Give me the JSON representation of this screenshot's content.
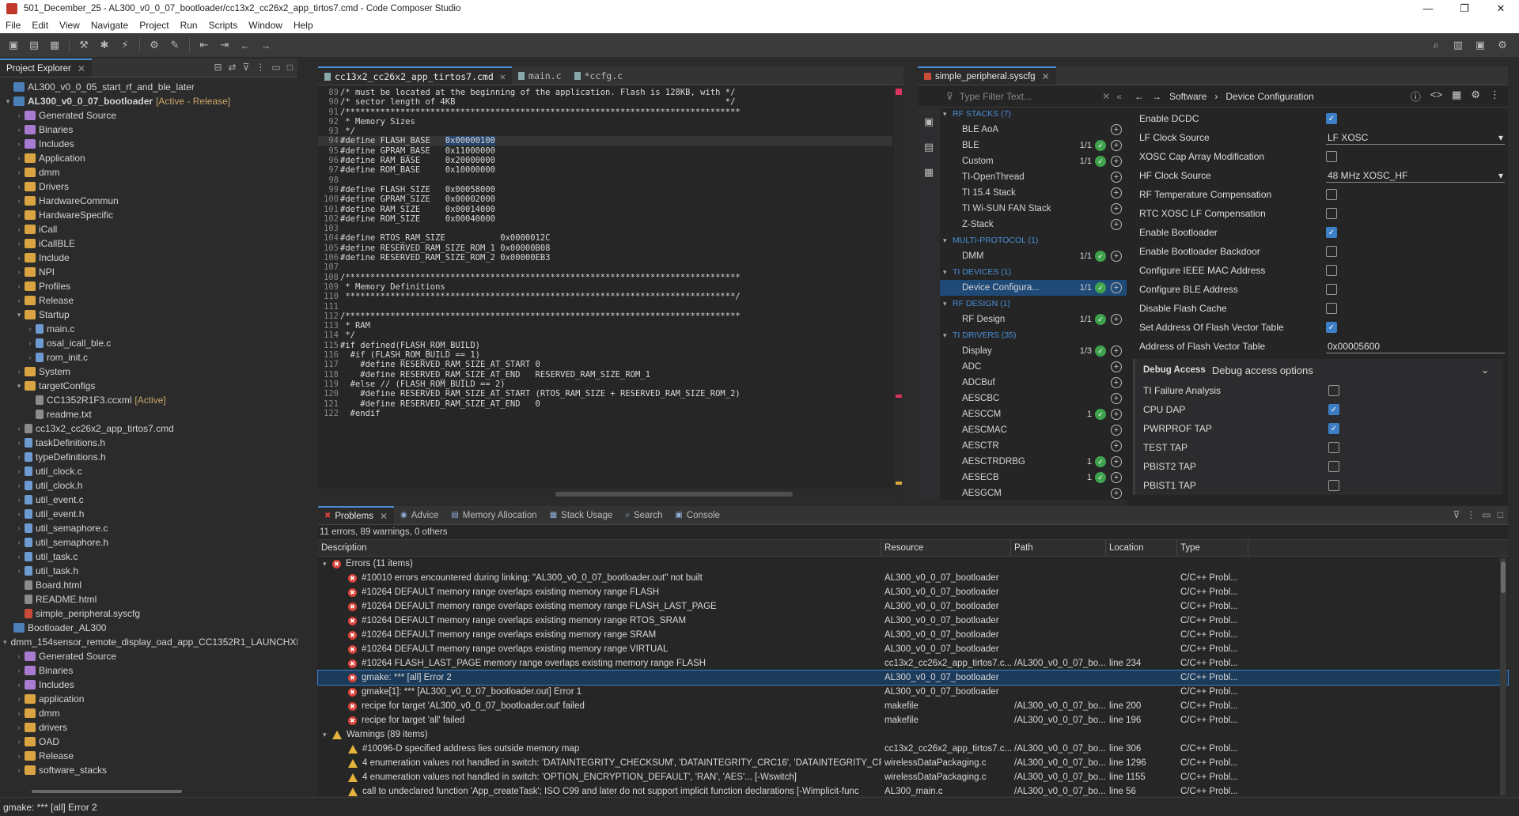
{
  "window": {
    "title": "501_December_25 - AL300_v0_0_07_bootloader/cc13x2_cc26x2_app_tirtos7.cmd - Code Composer Studio",
    "controls": [
      "—",
      "❐",
      "✕"
    ]
  },
  "menu": [
    "File",
    "Edit",
    "View",
    "Navigate",
    "Project",
    "Run",
    "Scripts",
    "Window",
    "Help"
  ],
  "explorer": {
    "title": "Project Explorer",
    "items": [
      {
        "d": 1,
        "tw": "",
        "ic": "proj",
        "label": "AL300_v0_0_05_start_rf_and_ble_later",
        "st": ""
      },
      {
        "d": 1,
        "tw": "▾",
        "ic": "proj",
        "label": "AL300_v0_0_07_bootloader",
        "st": "[Active - Release]",
        "bold": true
      },
      {
        "d": 2,
        "tw": "›",
        "ic": "bin",
        "label": "Generated Source",
        "st": ""
      },
      {
        "d": 2,
        "tw": "›",
        "ic": "bin",
        "label": "Binaries",
        "st": ""
      },
      {
        "d": 2,
        "tw": "›",
        "ic": "bin",
        "label": "Includes",
        "st": ""
      },
      {
        "d": 2,
        "tw": "›",
        "ic": "folder",
        "label": "Application",
        "st": ""
      },
      {
        "d": 2,
        "tw": "›",
        "ic": "folder",
        "label": "dmm",
        "st": ""
      },
      {
        "d": 2,
        "tw": "›",
        "ic": "folder",
        "label": "Drivers",
        "st": ""
      },
      {
        "d": 2,
        "tw": "›",
        "ic": "folder",
        "label": "HardwareCommun",
        "st": ""
      },
      {
        "d": 2,
        "tw": "›",
        "ic": "folder",
        "label": "HardwareSpecific",
        "st": ""
      },
      {
        "d": 2,
        "tw": "›",
        "ic": "folder",
        "label": "iCall",
        "st": ""
      },
      {
        "d": 2,
        "tw": "›",
        "ic": "folder",
        "label": "iCallBLE",
        "st": ""
      },
      {
        "d": 2,
        "tw": "›",
        "ic": "folder",
        "label": "Include",
        "st": ""
      },
      {
        "d": 2,
        "tw": "›",
        "ic": "folder",
        "label": "NPI",
        "st": ""
      },
      {
        "d": 2,
        "tw": "›",
        "ic": "folder",
        "label": "Profiles",
        "st": ""
      },
      {
        "d": 2,
        "tw": "›",
        "ic": "folder",
        "label": "Release",
        "st": ""
      },
      {
        "d": 2,
        "tw": "▾",
        "ic": "folder",
        "label": "Startup",
        "st": ""
      },
      {
        "d": 3,
        "tw": "›",
        "ic": "cfile",
        "label": "main.c",
        "st": ""
      },
      {
        "d": 3,
        "tw": "›",
        "ic": "cfile",
        "label": "osal_icall_ble.c",
        "st": ""
      },
      {
        "d": 3,
        "tw": "›",
        "ic": "cfile",
        "label": "rom_init.c",
        "st": ""
      },
      {
        "d": 2,
        "tw": "›",
        "ic": "folder",
        "label": "System",
        "st": ""
      },
      {
        "d": 2,
        "tw": "▾",
        "ic": "folder",
        "label": "targetConfigs",
        "st": ""
      },
      {
        "d": 3,
        "tw": "",
        "ic": "file",
        "label": "CC1352R1F3.ccxml",
        "st": "[Active]"
      },
      {
        "d": 3,
        "tw": "",
        "ic": "file",
        "label": "readme.txt",
        "st": ""
      },
      {
        "d": 2,
        "tw": "›",
        "ic": "file",
        "label": "cc13x2_cc26x2_app_tirtos7.cmd",
        "st": ""
      },
      {
        "d": 2,
        "tw": "›",
        "ic": "cfile",
        "label": "taskDefinitions.h",
        "st": ""
      },
      {
        "d": 2,
        "tw": "›",
        "ic": "cfile",
        "label": "typeDefinitions.h",
        "st": ""
      },
      {
        "d": 2,
        "tw": "›",
        "ic": "cfile",
        "label": "util_clock.c",
        "st": ""
      },
      {
        "d": 2,
        "tw": "›",
        "ic": "cfile",
        "label": "util_clock.h",
        "st": ""
      },
      {
        "d": 2,
        "tw": "›",
        "ic": "cfile",
        "label": "util_event.c",
        "st": ""
      },
      {
        "d": 2,
        "tw": "›",
        "ic": "cfile",
        "label": "util_event.h",
        "st": ""
      },
      {
        "d": 2,
        "tw": "›",
        "ic": "cfile",
        "label": "util_semaphore.c",
        "st": ""
      },
      {
        "d": 2,
        "tw": "›",
        "ic": "cfile",
        "label": "util_semaphore.h",
        "st": ""
      },
      {
        "d": 2,
        "tw": "›",
        "ic": "cfile",
        "label": "util_task.c",
        "st": ""
      },
      {
        "d": 2,
        "tw": "›",
        "ic": "cfile",
        "label": "util_task.h",
        "st": ""
      },
      {
        "d": 2,
        "tw": "",
        "ic": "file",
        "label": "Board.html",
        "st": ""
      },
      {
        "d": 2,
        "tw": "",
        "ic": "file",
        "label": "README.html",
        "st": ""
      },
      {
        "d": 2,
        "tw": "",
        "ic": "red",
        "label": "simple_peripheral.syscfg",
        "st": ""
      },
      {
        "d": 1,
        "tw": "",
        "ic": "proj",
        "label": "Bootloader_AL300",
        "st": ""
      },
      {
        "d": 1,
        "tw": "▾",
        "ic": "proj",
        "label": "dmm_154sensor_remote_display_oad_app_CC1352R1_LAUNCHXL",
        "st": ""
      },
      {
        "d": 2,
        "tw": "›",
        "ic": "bin",
        "label": "Generated Source",
        "st": ""
      },
      {
        "d": 2,
        "tw": "›",
        "ic": "bin",
        "label": "Binaries",
        "st": ""
      },
      {
        "d": 2,
        "tw": "›",
        "ic": "bin",
        "label": "Includes",
        "st": ""
      },
      {
        "d": 2,
        "tw": "›",
        "ic": "folder",
        "label": "application",
        "st": ""
      },
      {
        "d": 2,
        "tw": "›",
        "ic": "folder",
        "label": "dmm",
        "st": ""
      },
      {
        "d": 2,
        "tw": "›",
        "ic": "folder",
        "label": "drivers",
        "st": ""
      },
      {
        "d": 2,
        "tw": "›",
        "ic": "folder",
        "label": "OAD",
        "st": ""
      },
      {
        "d": 2,
        "tw": "›",
        "ic": "folder",
        "label": "Release",
        "st": ""
      },
      {
        "d": 2,
        "tw": "›",
        "ic": "folder",
        "label": "software_stacks",
        "st": ""
      }
    ]
  },
  "editor": {
    "tabs": [
      {
        "label": "cc13x2_cc26x2_app_tirtos7.cmd",
        "active": true
      },
      {
        "label": "main.c"
      },
      {
        "label": "*ccfg.c"
      }
    ],
    "lines": [
      {
        "n": "89",
        "t": "/* must be located at the beginning of the application. Flash is 128KB, with */",
        "c": "cm"
      },
      {
        "n": "90",
        "t": "/* sector length of 4KB                                                      */",
        "c": "cm"
      },
      {
        "n": "91",
        "t": "/*******************************************************************************",
        "c": "cm"
      },
      {
        "n": "92",
        "t": " * Memory Sizes",
        "c": "cm"
      },
      {
        "n": "93",
        "t": " */",
        "c": "cm"
      },
      {
        "n": "94",
        "t": "#define FLASH_BASE   0x00000100",
        "c": "def",
        "hl": true,
        "selv": "0x00000100"
      },
      {
        "n": "95",
        "t": "#define GPRAM_BASE   0x11000000",
        "c": "def"
      },
      {
        "n": "96",
        "t": "#define RAM_BASE     0x20000000",
        "c": "def"
      },
      {
        "n": "97",
        "t": "#define ROM_BASE     0x10000000",
        "c": "def"
      },
      {
        "n": "98",
        "t": "",
        "c": ""
      },
      {
        "n": "99",
        "t": "#define FLASH_SIZE   0x00058000",
        "c": "def"
      },
      {
        "n": "100",
        "t": "#define GPRAM_SIZE   0x00002000",
        "c": "def"
      },
      {
        "n": "101",
        "t": "#define RAM_SIZE     0x00014000",
        "c": "def"
      },
      {
        "n": "102",
        "t": "#define ROM_SIZE     0x00040000",
        "c": "def"
      },
      {
        "n": "103",
        "t": "",
        "c": ""
      },
      {
        "n": "104",
        "t": "#define RTOS_RAM_SIZE           0x0000012C",
        "c": "def"
      },
      {
        "n": "105",
        "t": "#define RESERVED_RAM_SIZE_ROM_1 0x00000B08",
        "c": "def"
      },
      {
        "n": "106",
        "t": "#define RESERVED_RAM_SIZE_ROM_2 0x00000EB3",
        "c": "def"
      },
      {
        "n": "107",
        "t": "",
        "c": ""
      },
      {
        "n": "108",
        "t": "/*******************************************************************************",
        "c": "cm"
      },
      {
        "n": "109",
        "t": " * Memory Definitions",
        "c": "cm"
      },
      {
        "n": "110",
        "t": " ******************************************************************************/",
        "c": "cm"
      },
      {
        "n": "111",
        "t": "",
        "c": ""
      },
      {
        "n": "112",
        "t": "/*******************************************************************************",
        "c": "cm"
      },
      {
        "n": "113",
        "t": " * RAM",
        "c": "cm"
      },
      {
        "n": "114",
        "t": " */",
        "c": "cm"
      },
      {
        "n": "115",
        "t": "#if defined(FLASH_ROM_BUILD)",
        "c": "def"
      },
      {
        "n": "116",
        "t": "  #if (FLASH_ROM_BUILD == 1)",
        "c": "def"
      },
      {
        "n": "117",
        "t": "    #define RESERVED_RAM_SIZE_AT_START 0",
        "c": "def"
      },
      {
        "n": "118",
        "t": "    #define RESERVED_RAM_SIZE_AT_END   RESERVED_RAM_SIZE_ROM_1",
        "c": "def"
      },
      {
        "n": "119",
        "t": "  #else // (FLASH_ROM_BUILD == 2)",
        "c": "def"
      },
      {
        "n": "120",
        "t": "    #define RESERVED_RAM_SIZE_AT_START (RTOS_RAM_SIZE + RESERVED_RAM_SIZE_ROM_2)",
        "c": "def"
      },
      {
        "n": "121",
        "t": "    #define RESERVED_RAM_SIZE_AT_END   0",
        "c": "def"
      },
      {
        "n": "122",
        "t": "  #endif",
        "c": "def"
      }
    ]
  },
  "syscfg": {
    "tab": "simple_peripheral.syscfg",
    "filter_placeholder": "Type Filter Text...",
    "modules": [
      {
        "h": true,
        "label": "RF STACKS (7)"
      },
      {
        "label": "BLE AoA",
        "cnt": "",
        "ok": false
      },
      {
        "label": "BLE",
        "cnt": "1/1",
        "ok": true
      },
      {
        "label": "Custom",
        "cnt": "1/1",
        "ok": true
      },
      {
        "label": "TI-OpenThread",
        "cnt": "",
        "ok": false
      },
      {
        "label": "TI 15.4 Stack",
        "cnt": "",
        "ok": false
      },
      {
        "label": "TI Wi-SUN FAN Stack",
        "cnt": "",
        "ok": false
      },
      {
        "label": "Z-Stack",
        "cnt": "",
        "ok": false
      },
      {
        "h": true,
        "label": "MULTI-PROTOCOL (1)"
      },
      {
        "label": "DMM",
        "cnt": "1/1",
        "ok": true
      },
      {
        "h": true,
        "label": "TI DEVICES (1)"
      },
      {
        "label": "Device Configura...",
        "cnt": "1/1",
        "ok": true,
        "sel": true
      },
      {
        "h": true,
        "label": "RF DESIGN (1)"
      },
      {
        "label": "RF Design",
        "cnt": "1/1",
        "ok": true
      },
      {
        "h": true,
        "label": "TI DRIVERS (35)"
      },
      {
        "label": "Display",
        "cnt": "1/3",
        "ok": true
      },
      {
        "label": "ADC",
        "cnt": "",
        "ok": false
      },
      {
        "label": "ADCBuf",
        "cnt": "",
        "ok": false
      },
      {
        "label": "AESCBC",
        "cnt": "",
        "ok": false
      },
      {
        "label": "AESCCM",
        "cnt": "1",
        "ok": true
      },
      {
        "label": "AESCMAC",
        "cnt": "",
        "ok": false
      },
      {
        "label": "AESCTR",
        "cnt": "",
        "ok": false
      },
      {
        "label": "AESCTRDRBG",
        "cnt": "1",
        "ok": true
      },
      {
        "label": "AESECB",
        "cnt": "1",
        "ok": true
      },
      {
        "label": "AESGCM",
        "cnt": "",
        "ok": false
      }
    ],
    "breadcrumb": [
      "Software",
      "Device Configuration"
    ],
    "props": [
      {
        "label": "Enable DCDC",
        "type": "cb",
        "on": true
      },
      {
        "label": "LF Clock Source",
        "type": "dd",
        "value": "LF XOSC"
      },
      {
        "label": "XOSC Cap Array Modification",
        "type": "cb",
        "on": false
      },
      {
        "label": "HF Clock Source",
        "type": "dd",
        "value": "48 MHz XOSC_HF"
      },
      {
        "label": "RF Temperature Compensation",
        "type": "cb",
        "on": false
      },
      {
        "label": "RTC XOSC LF Compensation",
        "type": "cb",
        "on": false
      },
      {
        "label": "Enable Bootloader",
        "type": "cb",
        "on": true
      },
      {
        "label": "Enable Bootloader Backdoor",
        "type": "cb",
        "on": false
      },
      {
        "label": "Configure IEEE MAC Address",
        "type": "cb",
        "on": false
      },
      {
        "label": "Configure BLE Address",
        "type": "cb",
        "on": false
      },
      {
        "label": "Disable Flash Cache",
        "type": "cb",
        "on": false
      },
      {
        "label": "Set Address Of Flash Vector Table",
        "type": "cb",
        "on": true
      },
      {
        "label": "Address of Flash Vector Table",
        "type": "tf",
        "value": "0x00005600"
      }
    ],
    "group": {
      "title": "Debug Access",
      "subtitle": "Debug access options",
      "props": [
        {
          "label": "TI Failure Analysis",
          "on": false
        },
        {
          "label": "CPU DAP",
          "on": true
        },
        {
          "label": "PWRPROF TAP",
          "on": true
        },
        {
          "label": "TEST TAP",
          "on": false
        },
        {
          "label": "PBIST2 TAP",
          "on": false
        },
        {
          "label": "PBIST1 TAP",
          "on": false
        }
      ]
    }
  },
  "problems": {
    "tabs": [
      "Problems",
      "Advice",
      "Memory Allocation",
      "Stack Usage",
      "Search",
      "Console"
    ],
    "summary": "11 errors, 89 warnings, 0 others",
    "columns": [
      "Description",
      "Resource",
      "Path",
      "Location",
      "Type"
    ],
    "rows": [
      {
        "k": "grp",
        "ic": "e",
        "d": "Errors (11 items)",
        "r": "",
        "p": "",
        "l": "",
        "t": ""
      },
      {
        "k": "e",
        "d": "#10010 errors encountered during linking; \"AL300_v0_0_07_bootloader.out\" not built",
        "r": "AL300_v0_0_07_bootloader",
        "p": "",
        "l": "",
        "t": "C/C++ Probl..."
      },
      {
        "k": "e",
        "d": "#10264 DEFAULT memory range overlaps existing memory range FLASH",
        "r": "AL300_v0_0_07_bootloader",
        "p": "",
        "l": "",
        "t": "C/C++ Probl..."
      },
      {
        "k": "e",
        "d": "#10264 DEFAULT memory range overlaps existing memory range FLASH_LAST_PAGE",
        "r": "AL300_v0_0_07_bootloader",
        "p": "",
        "l": "",
        "t": "C/C++ Probl..."
      },
      {
        "k": "e",
        "d": "#10264 DEFAULT memory range overlaps existing memory range RTOS_SRAM",
        "r": "AL300_v0_0_07_bootloader",
        "p": "",
        "l": "",
        "t": "C/C++ Probl..."
      },
      {
        "k": "e",
        "d": "#10264 DEFAULT memory range overlaps existing memory range SRAM",
        "r": "AL300_v0_0_07_bootloader",
        "p": "",
        "l": "",
        "t": "C/C++ Probl..."
      },
      {
        "k": "e",
        "d": "#10264 DEFAULT memory range overlaps existing memory range VIRTUAL",
        "r": "AL300_v0_0_07_bootloader",
        "p": "",
        "l": "",
        "t": "C/C++ Probl..."
      },
      {
        "k": "e",
        "d": "#10264 FLASH_LAST_PAGE memory range overlaps existing memory range FLASH",
        "r": "cc13x2_cc26x2_app_tirtos7.c...",
        "p": "/AL300_v0_0_07_bo...",
        "l": "line 234",
        "t": "C/C++ Probl..."
      },
      {
        "k": "e",
        "d": "gmake: *** [all] Error 2",
        "r": "AL300_v0_0_07_bootloader",
        "p": "",
        "l": "",
        "t": "C/C++ Probl...",
        "sel": true
      },
      {
        "k": "e",
        "d": "gmake[1]: *** [AL300_v0_0_07_bootloader.out] Error 1",
        "r": "AL300_v0_0_07_bootloader",
        "p": "",
        "l": "",
        "t": "C/C++ Probl..."
      },
      {
        "k": "e",
        "d": "recipe for target 'AL300_v0_0_07_bootloader.out' failed",
        "r": "makefile",
        "p": "/AL300_v0_0_07_bo...",
        "l": "line 200",
        "t": "C/C++ Probl..."
      },
      {
        "k": "e",
        "d": "recipe for target 'all' failed",
        "r": "makefile",
        "p": "/AL300_v0_0_07_bo...",
        "l": "line 196",
        "t": "C/C++ Probl..."
      },
      {
        "k": "grp",
        "ic": "w",
        "d": "Warnings (89 items)",
        "r": "",
        "p": "",
        "l": "",
        "t": ""
      },
      {
        "k": "w",
        "d": "#10096-D specified address lies outside memory map",
        "r": "cc13x2_cc26x2_app_tirtos7.c...",
        "p": "/AL300_v0_0_07_bo...",
        "l": "line 306",
        "t": "C/C++ Probl..."
      },
      {
        "k": "w",
        "d": "4 enumeration values not handled in switch: 'DATAINTEGRITY_CHECKSUM', 'DATAINTEGRITY_CRC16', 'DATAINTEGRITY_CRC",
        "r": "wirelessDataPackaging.c",
        "p": "/AL300_v0_0_07_bo...",
        "l": "line 1296",
        "t": "C/C++ Probl..."
      },
      {
        "k": "w",
        "d": "4 enumeration values not handled in switch: 'OPTION_ENCRYPTION_DEFAULT', 'RAN', 'AES'... [-Wswitch]",
        "r": "wirelessDataPackaging.c",
        "p": "/AL300_v0_0_07_bo...",
        "l": "line 1155",
        "t": "C/C++ Probl..."
      },
      {
        "k": "w",
        "d": "call to undeclared function 'App_createTask'; ISO C99 and later do not support implicit function declarations [-Wimplicit-func",
        "r": "AL300_main.c",
        "p": "/AL300_v0_0_07_bo...",
        "l": "line 56",
        "t": "C/C++ Probl..."
      }
    ]
  },
  "status": {
    "text": "gmake: *** [all] Error 2"
  }
}
